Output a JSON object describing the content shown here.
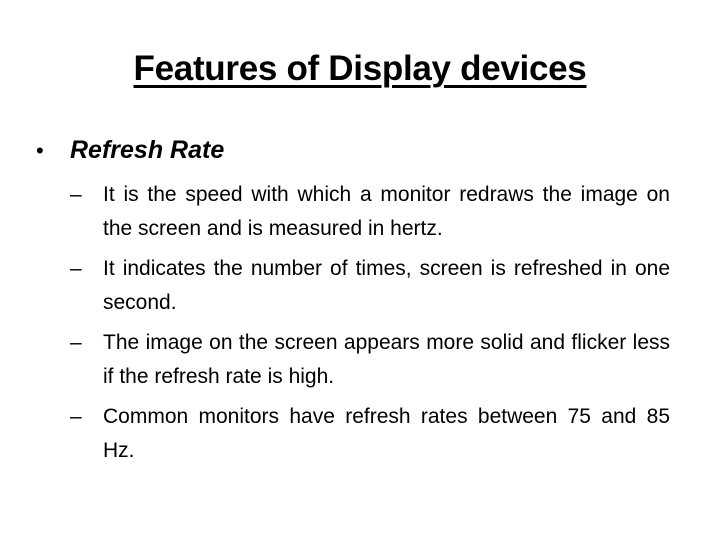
{
  "slide": {
    "title": "Features of Display devices",
    "bullets": [
      {
        "marker": "•",
        "label": "Refresh Rate",
        "subitems": [
          {
            "marker": "–",
            "text": "It is the speed with which a monitor redraws the image on the screen and is measured in hertz."
          },
          {
            "marker": "–",
            "text": "It indicates the number of times, screen is refreshed in one second."
          },
          {
            "marker": "–",
            "text": "The image on the screen appears more solid and flicker less if the refresh rate is high."
          },
          {
            "marker": "–",
            "text": "Common monitors have refresh rates between 75 and 85 Hz."
          }
        ]
      }
    ]
  }
}
